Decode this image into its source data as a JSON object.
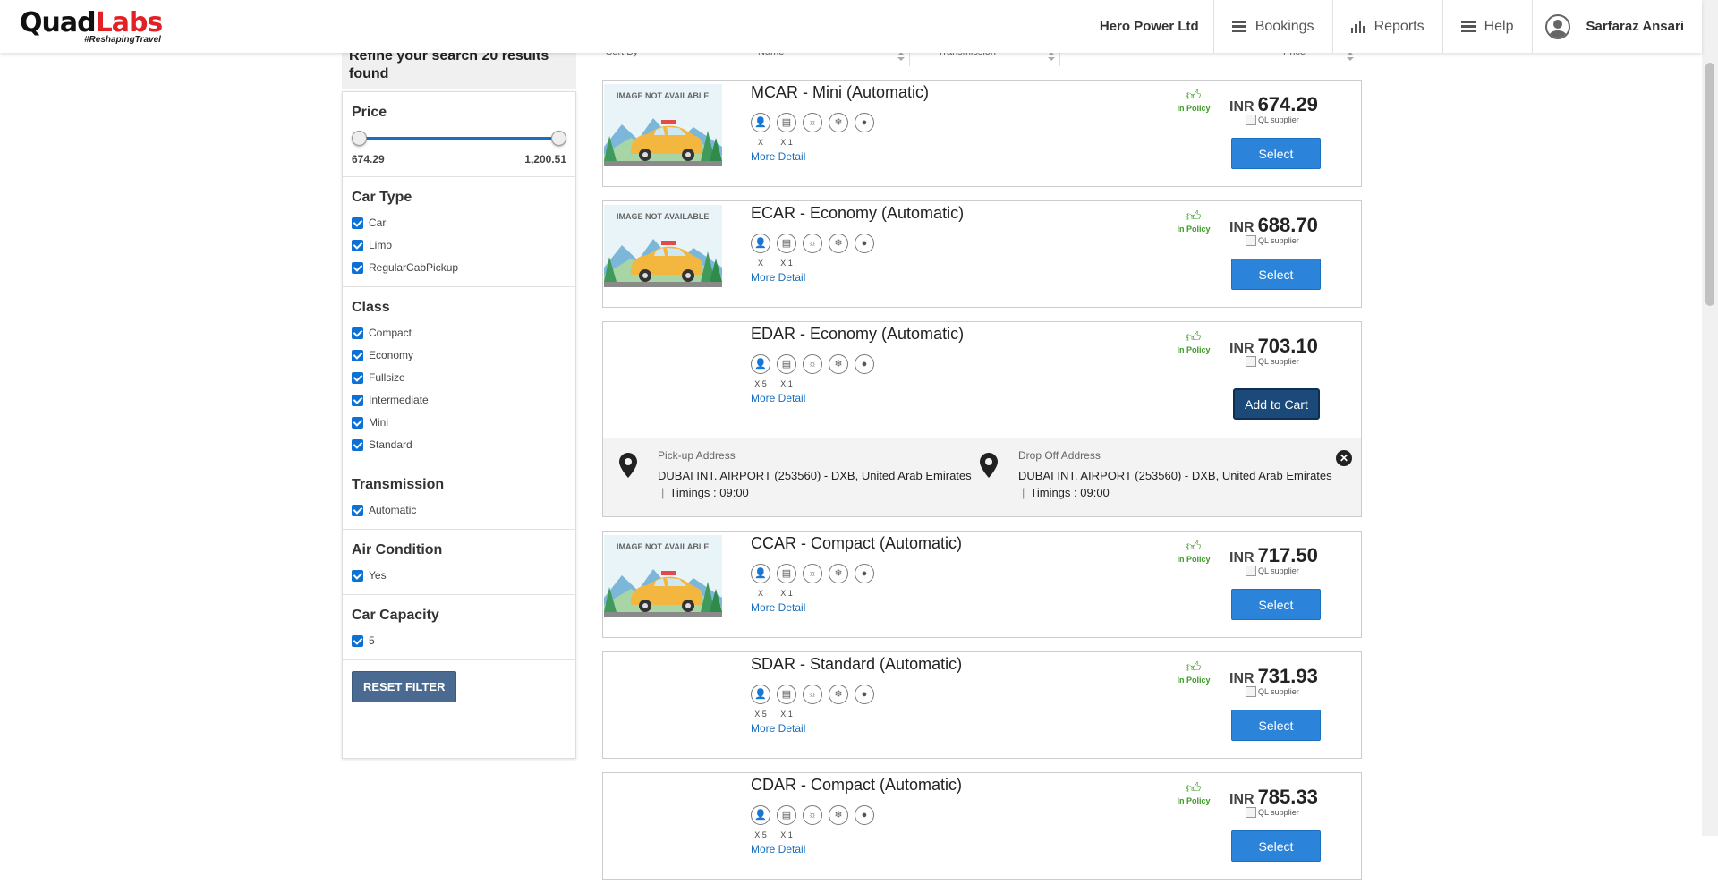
{
  "header": {
    "logo_text_a": "Quad",
    "logo_text_b": "Labs",
    "logo_tagline": "#ReshapingTravel",
    "company": "Hero Power Ltd",
    "nav": [
      {
        "label": "Bookings",
        "icon": "menu-icon"
      },
      {
        "label": "Reports",
        "icon": "bar-chart-icon"
      },
      {
        "label": "Help",
        "icon": "menu-icon"
      }
    ],
    "user": "Sarfaraz Ansari"
  },
  "sidebar": {
    "heading": "Refine your search 20 results found",
    "price": {
      "title": "Price",
      "min": "674.29",
      "max": "1,200.51",
      "range_low_fraction": 0.0,
      "range_high_fraction": 1.0
    },
    "car_type": {
      "title": "Car Type",
      "options": [
        "Car",
        "Limo",
        "RegularCabPickup"
      ]
    },
    "class": {
      "title": "Class",
      "options": [
        "Compact",
        "Economy",
        "Fullsize",
        "Intermediate",
        "Mini",
        "Standard"
      ]
    },
    "transmission": {
      "title": "Transmission",
      "options": [
        "Automatic"
      ]
    },
    "air_condition": {
      "title": "Air Condition",
      "options": [
        "Yes"
      ]
    },
    "capacity": {
      "title": "Car Capacity",
      "options": [
        "5"
      ]
    },
    "reset": "RESET FILTER"
  },
  "sortbar": {
    "sort_by": "Sort By",
    "name": "Name",
    "transmission": "Transmission",
    "price": "Price"
  },
  "image_placeholder": "IMAGE NOT AVAILABLE",
  "common": {
    "more_detail": "More Detail",
    "in_policy": "In Policy",
    "currency": "INR",
    "supplier_alt": "QL supplier",
    "select": "Select",
    "add_to_cart": "Add to Cart"
  },
  "cars": [
    {
      "name": "MCAR - Mini (Automatic)",
      "price": "674.29",
      "pax": "X",
      "bags": "X 1",
      "has_image": true
    },
    {
      "name": "ECAR - Economy (Automatic)",
      "price": "688.70",
      "pax": "X",
      "bags": "X 1",
      "has_image": true
    },
    {
      "name": "EDAR - Economy (Automatic)",
      "price": "703.10",
      "pax": "X 5",
      "bags": "X 1",
      "has_image": false
    },
    {
      "name": "CCAR - Compact (Automatic)",
      "price": "717.50",
      "pax": "X",
      "bags": "X 1",
      "has_image": true
    },
    {
      "name": "SDAR - Standard (Automatic)",
      "price": "731.93",
      "pax": "X 5",
      "bags": "X 1",
      "has_image": false
    },
    {
      "name": "CDAR - Compact (Automatic)",
      "price": "785.33",
      "pax": "X 5",
      "bags": "X 1",
      "has_image": false
    }
  ],
  "expanded": {
    "pickup_label": "Pick-up Address",
    "pickup_address": "DUBAI INT. AIRPORT (253560) - DXB, United Arab Emirates",
    "pickup_timing": "Timings : 09:00",
    "dropoff_label": "Drop Off Address",
    "dropoff_address": "DUBAI INT. AIRPORT (253560) - DXB, United Arab Emirates",
    "dropoff_timing": "Timings : 09:00",
    "separator": "|"
  },
  "colors": {
    "accent": "#2b84d9",
    "cart": "#1b4a7a",
    "policy": "#3a9a22",
    "logo_red": "#e22127",
    "reset": "#4a6a91"
  }
}
